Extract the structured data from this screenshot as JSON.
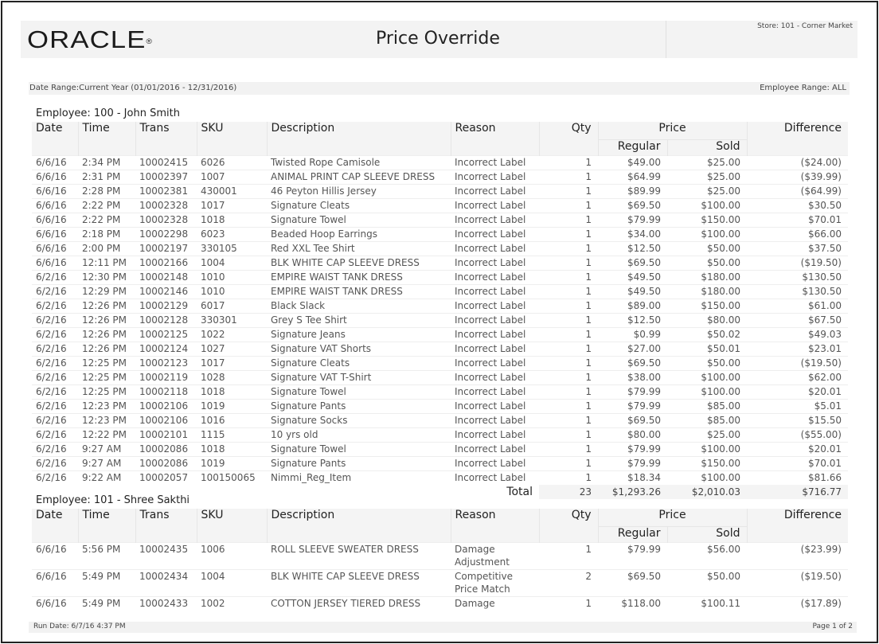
{
  "header": {
    "logo": "ORACLE",
    "title": "Price Override",
    "store": "Store: 101 - Corner Market"
  },
  "filters": {
    "date_range": "Date Range:Current Year (01/01/2016 - 12/31/2016)",
    "employee_range": "Employee Range: ALL"
  },
  "columns": {
    "date": "Date",
    "time": "Time",
    "trans": "Trans",
    "sku": "SKU",
    "description": "Description",
    "reason": "Reason",
    "qty": "Qty",
    "price": "Price",
    "regular": "Regular",
    "sold": "Sold",
    "difference": "Difference"
  },
  "employees": [
    {
      "label": "Employee: 100 - John Smith",
      "rows": [
        [
          "6/6/16",
          "2:34 PM",
          "10002415",
          "6026",
          "Twisted Rope Camisole",
          "Incorrect Label",
          "1",
          "$49.00",
          "$25.00",
          "($24.00)"
        ],
        [
          "6/6/16",
          "2:31 PM",
          "10002397",
          "1007",
          "ANIMAL PRINT CAP SLEEVE DRESS",
          "Incorrect Label",
          "1",
          "$64.99",
          "$25.00",
          "($39.99)"
        ],
        [
          "6/6/16",
          "2:28 PM",
          "10002381",
          "430001",
          "46 Peyton Hillis Jersey",
          "Incorrect Label",
          "1",
          "$89.99",
          "$25.00",
          "($64.99)"
        ],
        [
          "6/6/16",
          "2:22 PM",
          "10002328",
          "1017",
          "Signature Cleats",
          "Incorrect Label",
          "1",
          "$69.50",
          "$100.00",
          "$30.50"
        ],
        [
          "6/6/16",
          "2:22 PM",
          "10002328",
          "1018",
          "Signature Towel",
          "Incorrect Label",
          "1",
          "$79.99",
          "$150.00",
          "$70.01"
        ],
        [
          "6/6/16",
          "2:18 PM",
          "10002298",
          "6023",
          "Beaded Hoop Earrings",
          "Incorrect Label",
          "1",
          "$34.00",
          "$100.00",
          "$66.00"
        ],
        [
          "6/6/16",
          "2:00 PM",
          "10002197",
          "330105",
          "Red XXL Tee Shirt",
          "Incorrect Label",
          "1",
          "$12.50",
          "$50.00",
          "$37.50"
        ],
        [
          "6/6/16",
          "12:11 PM",
          "10002166",
          "1004",
          "BLK WHITE CAP SLEEVE DRESS",
          "Incorrect Label",
          "1",
          "$69.50",
          "$50.00",
          "($19.50)"
        ],
        [
          "6/2/16",
          "12:30 PM",
          "10002148",
          "1010",
          "EMPIRE WAIST TANK DRESS",
          "Incorrect Label",
          "1",
          "$49.50",
          "$180.00",
          "$130.50"
        ],
        [
          "6/2/16",
          "12:29 PM",
          "10002146",
          "1010",
          "EMPIRE WAIST TANK DRESS",
          "Incorrect Label",
          "1",
          "$49.50",
          "$180.00",
          "$130.50"
        ],
        [
          "6/2/16",
          "12:26 PM",
          "10002129",
          "6017",
          "Black Slack",
          "Incorrect Label",
          "1",
          "$89.00",
          "$150.00",
          "$61.00"
        ],
        [
          "6/2/16",
          "12:26 PM",
          "10002128",
          "330301",
          "Grey S Tee Shirt",
          "Incorrect Label",
          "1",
          "$12.50",
          "$80.00",
          "$67.50"
        ],
        [
          "6/2/16",
          "12:26 PM",
          "10002125",
          "1022",
          "Signature Jeans",
          "Incorrect Label",
          "1",
          "$0.99",
          "$50.02",
          "$49.03"
        ],
        [
          "6/2/16",
          "12:26 PM",
          "10002124",
          "1027",
          "Signature VAT Shorts",
          "Incorrect Label",
          "1",
          "$27.00",
          "$50.01",
          "$23.01"
        ],
        [
          "6/2/16",
          "12:25 PM",
          "10002123",
          "1017",
          "Signature Cleats",
          "Incorrect Label",
          "1",
          "$69.50",
          "$50.00",
          "($19.50)"
        ],
        [
          "6/2/16",
          "12:25 PM",
          "10002119",
          "1028",
          "Signature VAT T-Shirt",
          "Incorrect Label",
          "1",
          "$38.00",
          "$100.00",
          "$62.00"
        ],
        [
          "6/2/16",
          "12:25 PM",
          "10002118",
          "1018",
          "Signature Towel",
          "Incorrect Label",
          "1",
          "$79.99",
          "$100.00",
          "$20.01"
        ],
        [
          "6/2/16",
          "12:23 PM",
          "10002106",
          "1019",
          "Signature Pants",
          "Incorrect Label",
          "1",
          "$79.99",
          "$85.00",
          "$5.01"
        ],
        [
          "6/2/16",
          "12:23 PM",
          "10002106",
          "1016",
          "Signature Socks",
          "Incorrect Label",
          "1",
          "$69.50",
          "$85.00",
          "$15.50"
        ],
        [
          "6/2/16",
          "12:22 PM",
          "10002101",
          "1115",
          "10 yrs old",
          "Incorrect Label",
          "1",
          "$80.00",
          "$25.00",
          "($55.00)"
        ],
        [
          "6/2/16",
          "9:27 AM",
          "10002086",
          "1018",
          "Signature Towel",
          "Incorrect Label",
          "1",
          "$79.99",
          "$100.00",
          "$20.01"
        ],
        [
          "6/2/16",
          "9:27 AM",
          "10002086",
          "1019",
          "Signature Pants",
          "Incorrect Label",
          "1",
          "$79.99",
          "$150.00",
          "$70.01"
        ],
        [
          "6/2/16",
          "9:22 AM",
          "10002057",
          "100150065",
          "Nimmi_Reg_Item",
          "Incorrect Label",
          "1",
          "$18.34",
          "$100.00",
          "$81.66"
        ]
      ],
      "total": {
        "label": "Total",
        "qty": "23",
        "regular": "$1,293.26",
        "sold": "$2,010.03",
        "difference": "$716.77"
      }
    },
    {
      "label": "Employee: 101 - Shree Sakthi",
      "rows": [
        [
          "6/6/16",
          "5:56 PM",
          "10002435",
          "1006",
          "ROLL SLEEVE SWEATER DRESS",
          "Damage Adjustment",
          "1",
          "$79.99",
          "$56.00",
          "($23.99)"
        ],
        [
          "6/6/16",
          "5:49 PM",
          "10002434",
          "1004",
          "BLK WHITE CAP SLEEVE DRESS",
          "Competitive Price Match",
          "2",
          "$69.50",
          "$50.00",
          "($19.50)"
        ],
        [
          "6/6/16",
          "5:49 PM",
          "10002433",
          "1002",
          "COTTON JERSEY TIERED DRESS",
          "Damage",
          "1",
          "$118.00",
          "$100.11",
          "($17.89)"
        ]
      ]
    }
  ],
  "footer": {
    "run_date": "Run Date: 6/7/16 4:37 PM",
    "page": "Page 1 of 2"
  }
}
